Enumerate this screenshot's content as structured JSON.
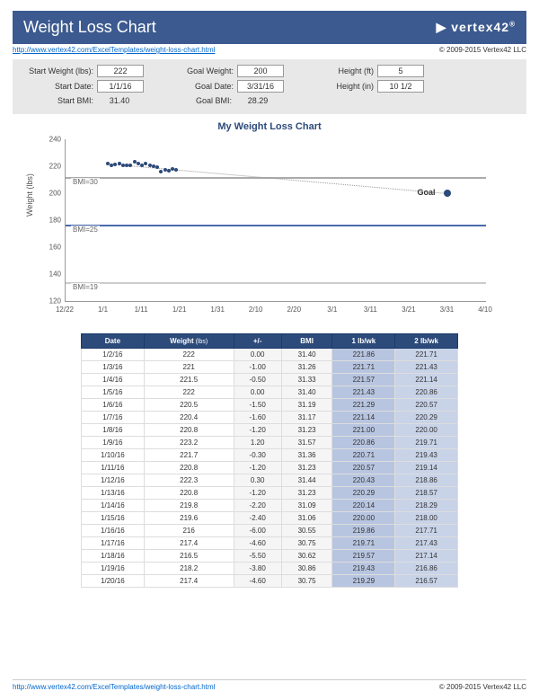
{
  "header": {
    "title": "Weight Loss Chart",
    "brand": "vertex42"
  },
  "link": "http://www.vertex42.com/ExcelTemplates/weight-loss-chart.html",
  "copyright": "© 2009-2015 Vertex42 LLC",
  "params": {
    "startWeightLabel": "Start Weight (lbs):",
    "startWeight": "222",
    "startDateLabel": "Start Date:",
    "startDate": "1/1/16",
    "startBmiLabel": "Start BMI:",
    "startBmi": "31.40",
    "goalWeightLabel": "Goal Weight:",
    "goalWeight": "200",
    "goalDateLabel": "Goal Date:",
    "goalDate": "3/31/16",
    "goalBmiLabel": "Goal BMI:",
    "goalBmi": "28.29",
    "heightFtLabel": "Height (ft)",
    "heightFt": "5",
    "heightInLabel": "Height (in)",
    "heightIn": "10 1/2"
  },
  "chart_data": {
    "type": "scatter",
    "title": "My Weight Loss Chart",
    "ylabel": "Weight (lbs)",
    "xlabel": "",
    "ylim": [
      120,
      240
    ],
    "yticks": [
      120,
      140,
      160,
      180,
      200,
      220,
      240
    ],
    "xticks": [
      "12/22",
      "1/1",
      "1/11",
      "1/21",
      "1/31",
      "2/10",
      "2/20",
      "3/1",
      "3/11",
      "3/21",
      "3/31",
      "4/10"
    ],
    "references": [
      {
        "label": "BMI=30",
        "y": 212
      },
      {
        "label": "BMI=25",
        "y": 177
      },
      {
        "label": "BMI=19",
        "y": 134
      }
    ],
    "goal": {
      "label": "Goal",
      "x": "3/31",
      "y": 200
    },
    "data": [
      {
        "x": "1/2/16",
        "y": 222
      },
      {
        "x": "1/3/16",
        "y": 221
      },
      {
        "x": "1/4/16",
        "y": 221.5
      },
      {
        "x": "1/5/16",
        "y": 222
      },
      {
        "x": "1/6/16",
        "y": 220.5
      },
      {
        "x": "1/7/16",
        "y": 220.4
      },
      {
        "x": "1/8/16",
        "y": 220.8
      },
      {
        "x": "1/9/16",
        "y": 223.2
      },
      {
        "x": "1/10/16",
        "y": 221.7
      },
      {
        "x": "1/11/16",
        "y": 220.8
      },
      {
        "x": "1/12/16",
        "y": 222.3
      },
      {
        "x": "1/13/16",
        "y": 220.8
      },
      {
        "x": "1/14/16",
        "y": 219.8
      },
      {
        "x": "1/15/16",
        "y": 219.6
      },
      {
        "x": "1/16/16",
        "y": 216
      },
      {
        "x": "1/17/16",
        "y": 217.4
      },
      {
        "x": "1/18/16",
        "y": 216.5
      },
      {
        "x": "1/19/16",
        "y": 218.2
      },
      {
        "x": "1/20/16",
        "y": 217.4
      }
    ]
  },
  "table": {
    "headers": [
      "Date",
      "Weight",
      "+/-",
      "BMI",
      "1 lb/wk",
      "2 lb/wk"
    ],
    "weightUnit": "(lbs)",
    "rows": [
      [
        "1/2/16",
        "222",
        "0.00",
        "31.40",
        "221.86",
        "221.71"
      ],
      [
        "1/3/16",
        "221",
        "-1.00",
        "31.26",
        "221.71",
        "221.43"
      ],
      [
        "1/4/16",
        "221.5",
        "-0.50",
        "31.33",
        "221.57",
        "221.14"
      ],
      [
        "1/5/16",
        "222",
        "0.00",
        "31.40",
        "221.43",
        "220.86"
      ],
      [
        "1/6/16",
        "220.5",
        "-1.50",
        "31.19",
        "221.29",
        "220.57"
      ],
      [
        "1/7/16",
        "220.4",
        "-1.60",
        "31.17",
        "221.14",
        "220.29"
      ],
      [
        "1/8/16",
        "220.8",
        "-1.20",
        "31.23",
        "221.00",
        "220.00"
      ],
      [
        "1/9/16",
        "223.2",
        "1.20",
        "31.57",
        "220.86",
        "219.71"
      ],
      [
        "1/10/16",
        "221.7",
        "-0.30",
        "31.36",
        "220.71",
        "219.43"
      ],
      [
        "1/11/16",
        "220.8",
        "-1.20",
        "31.23",
        "220.57",
        "219.14"
      ],
      [
        "1/12/16",
        "222.3",
        "0.30",
        "31.44",
        "220.43",
        "218.86"
      ],
      [
        "1/13/16",
        "220.8",
        "-1.20",
        "31.23",
        "220.29",
        "218.57"
      ],
      [
        "1/14/16",
        "219.8",
        "-2.20",
        "31.09",
        "220.14",
        "218.29"
      ],
      [
        "1/15/16",
        "219.6",
        "-2.40",
        "31.06",
        "220.00",
        "218.00"
      ],
      [
        "1/16/16",
        "216",
        "-6.00",
        "30.55",
        "219.86",
        "217.71"
      ],
      [
        "1/17/16",
        "217.4",
        "-4.60",
        "30.75",
        "219.71",
        "217.43"
      ],
      [
        "1/18/16",
        "216.5",
        "-5.50",
        "30.62",
        "219.57",
        "217.14"
      ],
      [
        "1/19/16",
        "218.2",
        "-3.80",
        "30.86",
        "219.43",
        "216.86"
      ],
      [
        "1/20/16",
        "217.4",
        "-4.60",
        "30.75",
        "219.29",
        "216.57"
      ]
    ]
  }
}
